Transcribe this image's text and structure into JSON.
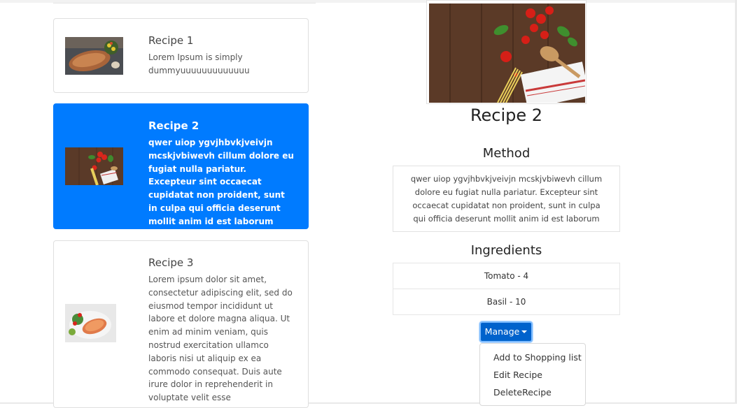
{
  "recipes": [
    {
      "title": "Recipe 1",
      "description": "Lorem Ipsum is simply dummyuuuuuuuuuuuuu",
      "active": false
    },
    {
      "title": "Recipe 2",
      "description": "qwer uiop ygvjhbvkjveivjn mcskjvbiwevh cillum dolore eu fugiat nulla pariatur. Excepteur sint occaecat cupidatat non proident, sunt in culpa qui officia deserunt mollit anim id est laborum",
      "active": true
    },
    {
      "title": "Recipe 3",
      "description": "Lorem ipsum dolor sit amet, consectetur adipiscing elit, sed do eiusmod tempor incididunt ut labore et dolore magna aliqua. Ut enim ad minim veniam, quis nostrud exercitation ullamco laboris nisi ut aliquip ex ea commodo consequat. Duis aute irure dolor in reprehenderit in voluptate velit esse",
      "active": false
    }
  ],
  "detail": {
    "title": "Recipe 2",
    "method_heading": "Method",
    "method_text": "qwer uiop ygvjhbvkjveivjn mcskjvbiwevh cillum dolore eu fugiat nulla pariatur. Excepteur sint occaecat cupidatat non proident, sunt in culpa qui officia deserunt mollit anim id est laborum",
    "ingredients_heading": "Ingredients",
    "ingredients": [
      "Tomato - 4",
      "Basil - 10"
    ]
  },
  "manage": {
    "label": "Manage",
    "menu": [
      "Add to Shopping list",
      "Edit Recipe",
      "DeleteRecipe"
    ]
  },
  "colors": {
    "active_card": "#007bff",
    "manage_button": "#0062cc"
  },
  "icons": {
    "dropdown": "caret-down-icon"
  }
}
